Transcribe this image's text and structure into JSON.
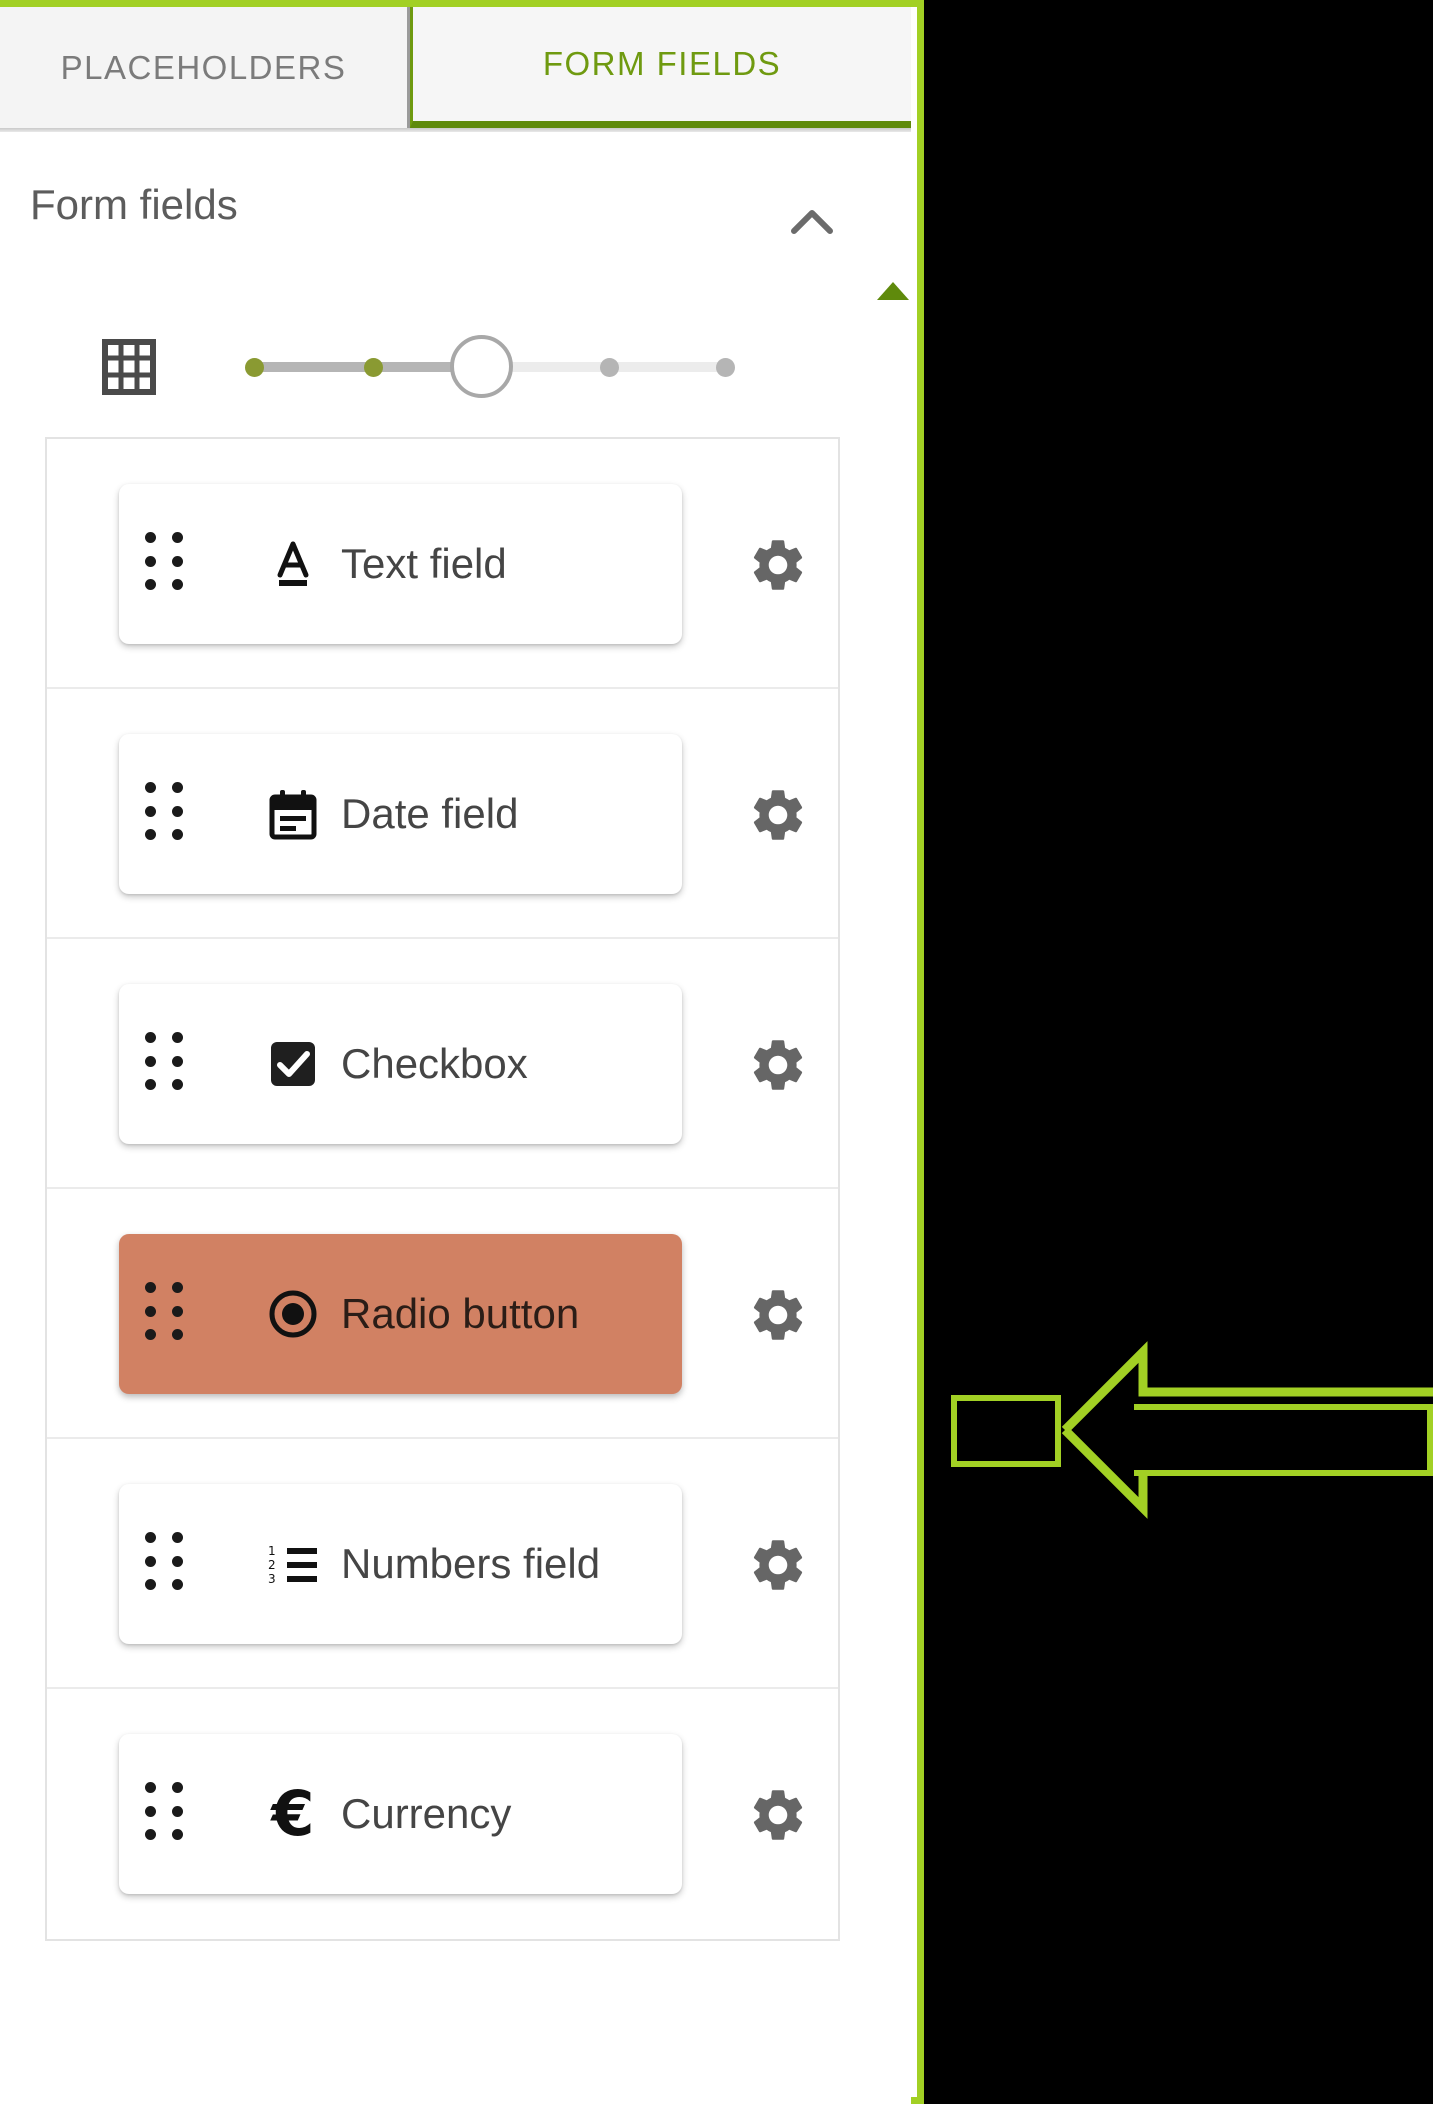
{
  "window": {
    "title": "Form fields panel",
    "accent_green": "#A2D024",
    "tab_active_green": "#6F9A10",
    "selected_row_color": "#D18163"
  },
  "tabs": [
    {
      "label": "PLACEHOLDERS",
      "active": false,
      "name": "tab-placeholders"
    },
    {
      "label": "FORM FIELDS",
      "active": true,
      "name": "tab-form-fields"
    }
  ],
  "section": {
    "title": "Form fields",
    "collapse_icon": "chevron-up-icon",
    "marker_icon": "green-triangle-marker"
  },
  "scale": {
    "grid_icon": "grid-table-icon",
    "slider_name": "size-scale-slider",
    "ticks": 5,
    "ticks_filled": 2,
    "handle_position_index": 3,
    "value": 3,
    "min": 1,
    "max": 5
  },
  "field_list": [
    {
      "label": "Text field",
      "icon": "text-format-icon",
      "drag_handle": "drag-handle-icon",
      "gear": "gear-icon",
      "selected": false
    },
    {
      "label": "Date field",
      "icon": "calendar-icon",
      "drag_handle": "drag-handle-icon",
      "gear": "gear-icon",
      "selected": false
    },
    {
      "label": "Checkbox",
      "icon": "checkbox-checked-icon",
      "drag_handle": "drag-handle-icon",
      "gear": "gear-icon",
      "selected": false
    },
    {
      "label": "Radio button",
      "icon": "radio-button-selected-icon",
      "drag_handle": "drag-handle-icon",
      "gear": "gear-icon",
      "selected": true
    },
    {
      "label": "Numbers field",
      "icon": "numbered-list-icon",
      "drag_handle": "drag-handle-icon",
      "gear": "gear-icon",
      "selected": false
    },
    {
      "label": "Currency",
      "icon": "euro-currency-icon",
      "drag_handle": "drag-handle-icon",
      "gear": "gear-icon",
      "selected": false
    }
  ],
  "annotation": {
    "highlight_target": "gear-icon of Radio button row",
    "arrow_direction": "left",
    "arrow_color": "#A2D024"
  }
}
